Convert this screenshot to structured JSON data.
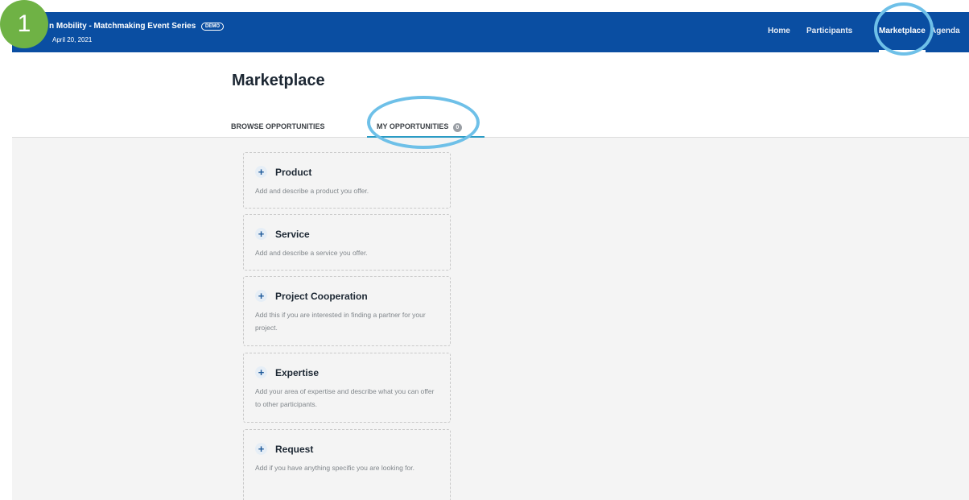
{
  "header": {
    "event_title": "n Mobility - Matchmaking Event Series",
    "demo_badge": "DEMO",
    "event_date": "April 20, 2021"
  },
  "nav": {
    "items": [
      {
        "label": "Home"
      },
      {
        "label": "Participants"
      },
      {
        "label": "Marketplace",
        "active": true
      },
      {
        "label": "Agenda"
      }
    ]
  },
  "page": {
    "title": "Marketplace"
  },
  "tabs": {
    "browse": "BROWSE OPPORTUNITIES",
    "mine": "MY OPPORTUNITIES",
    "mine_count": "0"
  },
  "cards": [
    {
      "title": "Product",
      "desc": "Add and describe a product you offer."
    },
    {
      "title": "Service",
      "desc": "Add and describe a service you offer."
    },
    {
      "title": "Project Cooperation",
      "desc": "Add this if you are interested in finding a partner for your project."
    },
    {
      "title": "Expertise",
      "desc": "Add your area of expertise and describe what you can offer to other participants."
    },
    {
      "title": "Request",
      "desc": "Add if you have anything specific you are looking for."
    }
  ],
  "annotation": {
    "step": "1"
  },
  "colors": {
    "topbar": "#0a4ea2",
    "accent": "#2a9bc4",
    "highlight_circle": "#6ec0e8",
    "step_badge": "#6fb245"
  }
}
